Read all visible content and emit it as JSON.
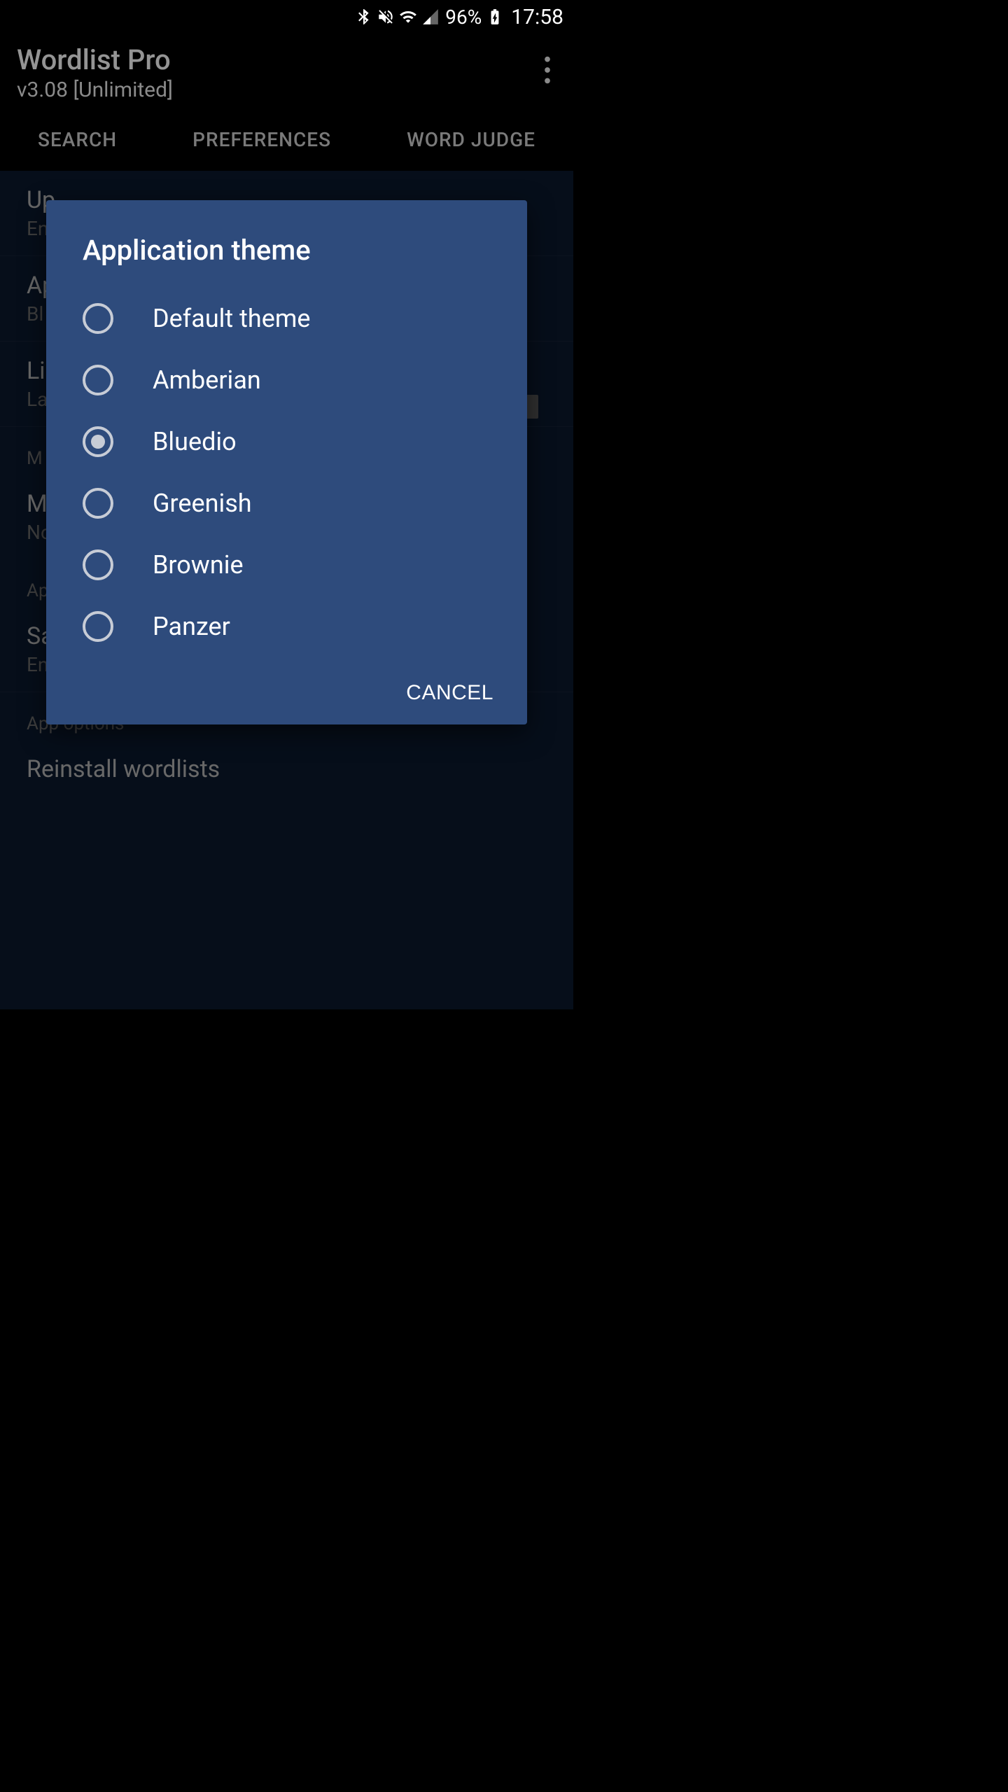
{
  "status": {
    "battery_pct": "96%",
    "time": "17:58"
  },
  "app": {
    "title": "Wordlist Pro",
    "subtitle": "v3.08 [Unlimited]"
  },
  "tabs": {
    "search": "SEARCH",
    "preferences": "PREFERENCES",
    "word_judge": "WORD JUDGE"
  },
  "prefs": {
    "item0_pri": "Up",
    "item0_sec": "En",
    "item1_pri": "Ap",
    "item1_sec": "Bl",
    "item2_pri": "Li",
    "item2_sec": "La",
    "section_m": "M",
    "item3_pri": "M",
    "item3_sec": "No",
    "section_a": "Ap",
    "item4_pri": "Sa",
    "item4_sec": "En",
    "section_app_options": "App options",
    "item5_pri": "Reinstall wordlists"
  },
  "dialog": {
    "title": "Application theme",
    "options": [
      {
        "label": "Default theme",
        "selected": false
      },
      {
        "label": "Amberian",
        "selected": false
      },
      {
        "label": "Bluedio",
        "selected": true
      },
      {
        "label": "Greenish",
        "selected": false
      },
      {
        "label": "Brownie",
        "selected": false
      },
      {
        "label": "Panzer",
        "selected": false
      }
    ],
    "cancel": "CANCEL"
  }
}
